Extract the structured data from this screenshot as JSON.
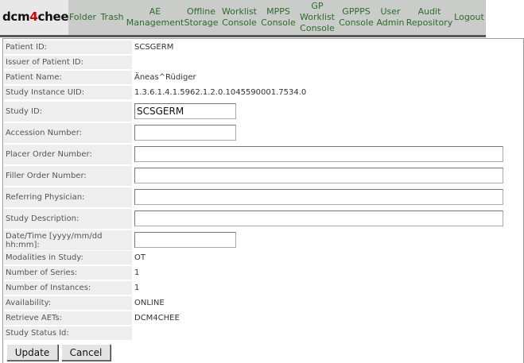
{
  "logo": {
    "text_a": "dcm",
    "text_b": "4",
    "text_c": "chee"
  },
  "nav": [
    {
      "label": "Folder"
    },
    {
      "label": "Trash"
    },
    {
      "label": "AE Management"
    },
    {
      "label": "Offline Storage"
    },
    {
      "label": "Worklist Console"
    },
    {
      "label": "MPPS Console"
    },
    {
      "label": "GP Worklist Console"
    },
    {
      "label": "GPPPS Console"
    },
    {
      "label": "User Admin"
    },
    {
      "label": "Audit Repository"
    },
    {
      "label": "Logout"
    }
  ],
  "fields": {
    "patient_id": {
      "label": "Patient ID:",
      "value": "SCSGERM"
    },
    "issuer": {
      "label": "Issuer of Patient ID:",
      "value": ""
    },
    "patient_name": {
      "label": "Patient Name:",
      "value": "Äneas^Rüdiger"
    },
    "study_uid": {
      "label": "Study Instance UID:",
      "value": "1.3.6.1.4.1.5962.1.2.0.1045590001.7534.0"
    },
    "study_id": {
      "label": "Study ID:",
      "value": "SCSGERM"
    },
    "accession": {
      "label": "Accession Number:",
      "value": ""
    },
    "placer": {
      "label": "Placer Order Number:",
      "value": ""
    },
    "filler": {
      "label": "Filler Order Number:",
      "value": ""
    },
    "referring": {
      "label": "Referring Physician:",
      "value": ""
    },
    "description": {
      "label": "Study Description:",
      "value": ""
    },
    "datetime": {
      "label": "Date/Time [yyyy/mm/dd hh:mm]:",
      "value": ""
    },
    "modalities": {
      "label": "Modalities in Study:",
      "value": "OT"
    },
    "num_series": {
      "label": "Number of Series:",
      "value": "1"
    },
    "num_instances": {
      "label": "Number of Instances:",
      "value": "1"
    },
    "availability": {
      "label": "Availability:",
      "value": "ONLINE"
    },
    "retrieve_aets": {
      "label": "Retrieve AETs:",
      "value": "DCM4CHEE"
    },
    "status_id": {
      "label": "Study Status Id:",
      "value": ""
    }
  },
  "buttons": {
    "update": "Update",
    "cancel": "Cancel"
  }
}
